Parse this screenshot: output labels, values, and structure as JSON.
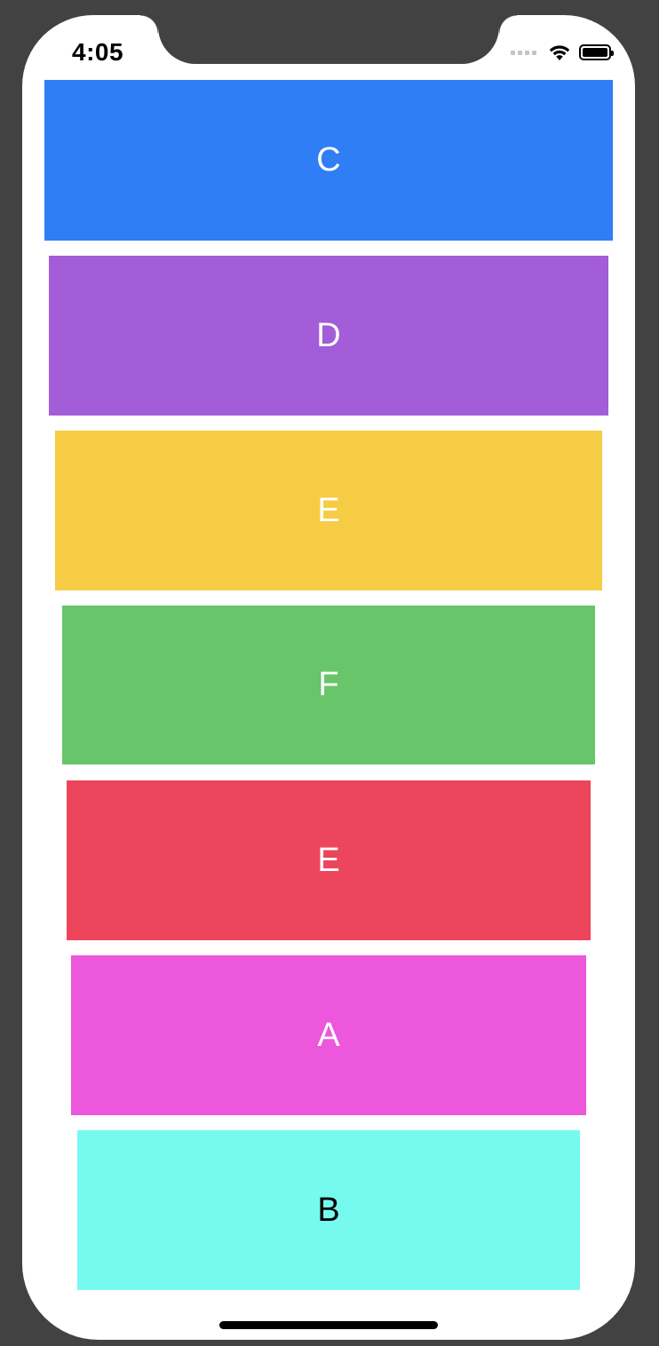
{
  "status_bar": {
    "time": "4:05",
    "icons": [
      "cellular-signal-icon",
      "wifi-icon",
      "battery-icon"
    ]
  },
  "cards": [
    {
      "label": "C",
      "color": "#2f7ef5",
      "text_color": "#ffffff"
    },
    {
      "label": "D",
      "color": "#a35dd8",
      "text_color": "#ffffff"
    },
    {
      "label": "E",
      "color": "#f6cc45",
      "text_color": "#ffffff"
    },
    {
      "label": "F",
      "color": "#68c569",
      "text_color": "#ffffff"
    },
    {
      "label": "E",
      "color": "#ec455c",
      "text_color": "#ffffff"
    },
    {
      "label": "A",
      "color": "#ed57dc",
      "text_color": "#ffffff"
    },
    {
      "label": "B",
      "color": "#76faf0",
      "text_color": "#000000"
    }
  ]
}
